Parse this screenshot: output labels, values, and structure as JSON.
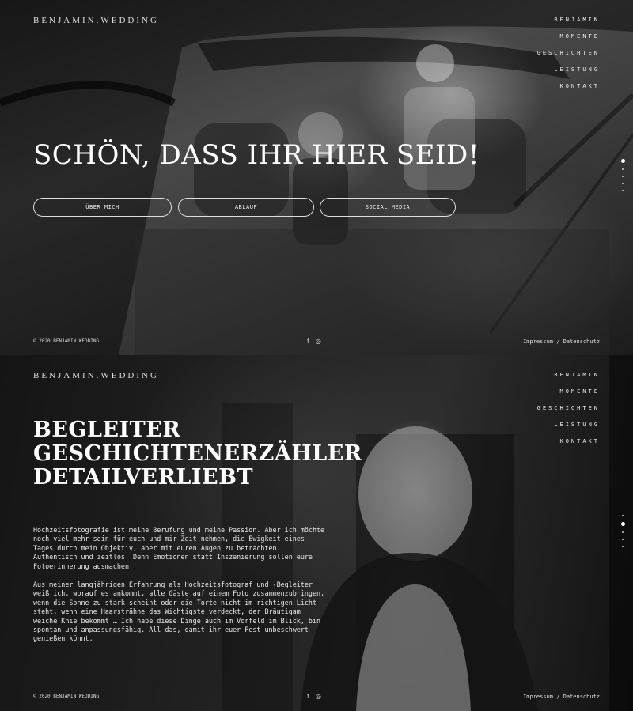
{
  "brand": "BENJAMIN.WEDDING",
  "nav": [
    "BENJAMIN",
    "MOMENTE",
    "GESCHICHTEN",
    "LEISTUNG",
    "KONTAKT"
  ],
  "hero": {
    "title": "SCHÖN, DASS IHR HIER SEID!",
    "buttons": [
      "ÜBER MICH",
      "ABLAUF",
      "SOCIAL MEDIA"
    ]
  },
  "about": {
    "headline": [
      "BEGLEITER",
      "GESCHICHTENERZÄHLER",
      "DETAILVERLIEBT"
    ],
    "paragraph1": [
      "Hochzeitsfotografie ist meine Berufung und meine Passion. Aber ich möchte",
      "noch viel mehr sein für euch und mir Zeit nehmen, die Ewigkeit eines",
      "Tages durch mein Objektiv, aber mit euren Augen zu betrachten.",
      "Authentisch und zeitlos. Denn Emotionen statt Inszenierung sollen eure",
      "Fotoerinnerung ausmachen."
    ],
    "paragraph2": [
      "Aus meiner langjährigen Erfahrung als Hochzeitsfotograf und -Begleiter",
      "weiß ich, worauf es ankommt, alle Gäste auf einem Foto zusammenzubringen,",
      "wenn die Sonne zu stark scheint oder die Torte nicht im richtigen Licht",
      "steht, wenn eine Haarsträhne das Wichtigste verdeckt, der Bräutigam",
      "weiche Knie bekommt … Ich habe diese Dinge auch im Vorfeld im Blick, bin",
      "spontan und anpassungsfähig. All das, damit ihr euer Fest unbeschwert",
      "genießen könnt."
    ]
  },
  "footer": {
    "copyright": "© 2020 BENJAMIN WEDDING",
    "legal": "Impressum / Datenschutz",
    "social_icons": [
      "facebook-icon",
      "instagram-icon"
    ]
  },
  "colors": {
    "text": "#ffffff",
    "background": "#1a1a1a"
  }
}
